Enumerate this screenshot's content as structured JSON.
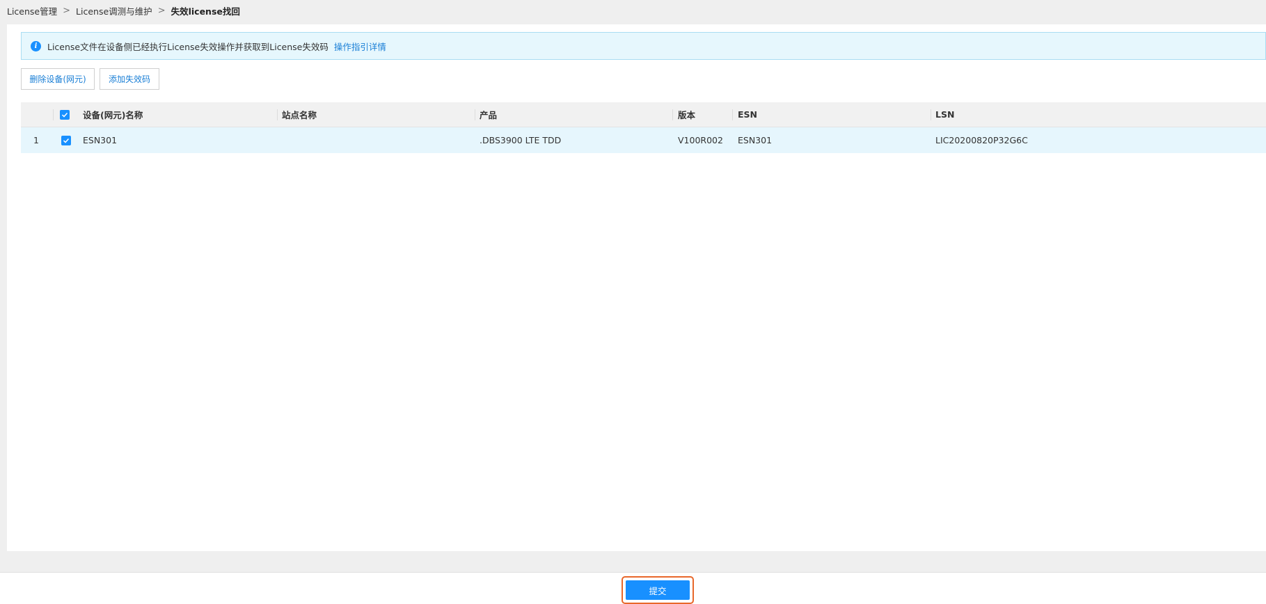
{
  "breadcrumb": {
    "items": [
      "License管理",
      "License调测与维护"
    ],
    "current": "失效license找回",
    "separator": ">"
  },
  "notice": {
    "icon": "info-icon",
    "icon_glyph": "i",
    "text": "License文件在设备侧已经执行License失效操作并获取到License失效码",
    "link": "操作指引详情"
  },
  "toolbar": {
    "delete_label": "删除设备(网元)",
    "add_label": "添加失效码"
  },
  "table": {
    "columns": [
      "设备(网元)名称",
      "站点名称",
      "产品",
      "版本",
      "ESN",
      "LSN"
    ],
    "rows": [
      {
        "index": "1",
        "checked": true,
        "device_name": "ESN301",
        "site_name": "",
        "product": ".DBS3900 LTE TDD",
        "version": "V100R002",
        "esn": "ESN301",
        "lsn": "LIC20200820P32G6C"
      }
    ]
  },
  "footer": {
    "submit_label": "提交"
  },
  "colors": {
    "accent": "#1890ff",
    "link": "#1a7fd6",
    "highlight_outline": "#e8672a",
    "notice_bg": "#e6f7fd",
    "row_selected_bg": "#e6f6fd"
  }
}
